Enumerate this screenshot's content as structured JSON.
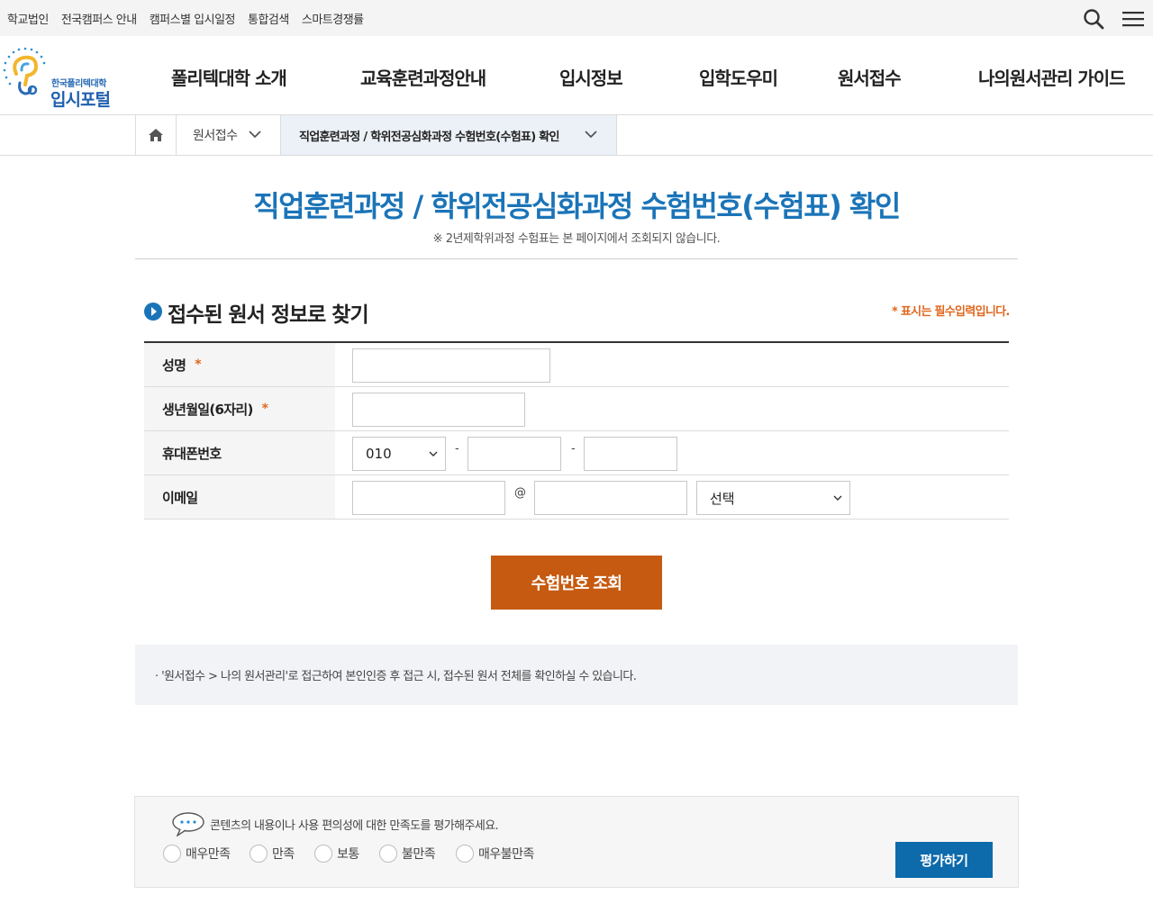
{
  "topbar": {
    "links": [
      "학교법인",
      "전국캠퍼스 안내",
      "캠퍼스별 입시일정",
      "통합검색",
      "스마트경쟁률"
    ]
  },
  "logo": {
    "sub": "한국폴리텍대학",
    "main": "입시포털"
  },
  "gnb": [
    "폴리텍대학 소개",
    "교육훈련과정안내",
    "입시정보",
    "입학도우미",
    "원서접수",
    "나의원서관리 가이드"
  ],
  "breadcrumb": {
    "level1": "원서접수",
    "level2": "직업훈련과정 / 학위전공심화과정 수험번호(수험표) 확인"
  },
  "page": {
    "title": "직업훈련과정 / 학위전공심화과정 수험번호(수험표) 확인",
    "notice": "※ 2년제학위과정 수험표는 본 페이지에서 조회되지 않습니다."
  },
  "section": {
    "title": "접수된 원서 정보로 찾기",
    "required_note": "* 표시는 필수입력입니다."
  },
  "form": {
    "name_label": "성명",
    "birth_label": "생년월일(6자리)",
    "phone_label": "휴대폰번호",
    "email_label": "이메일",
    "required_mark": "*",
    "phone_prefix": "010",
    "phone_sep": "-",
    "email_at": "@",
    "email_domain_select": "선택"
  },
  "submit_label": "수험번호 조회",
  "info_text": "· '원서접수 > 나의 원서관리'로 접근하여 본인인증 후 접근 시, 접수된 원서 전체를 확인하실 수 있습니다.",
  "survey": {
    "question": "콘텐츠의 내용이나 사용 편의성에 대한 만족도를 평가해주세요.",
    "options": [
      "매우만족",
      "만족",
      "보통",
      "불만족",
      "매우불만족"
    ],
    "button": "평가하기"
  },
  "colors": {
    "title_blue": "#1a74b8",
    "accent_orange": "#c65a10",
    "button_blue": "#0d6aab"
  }
}
